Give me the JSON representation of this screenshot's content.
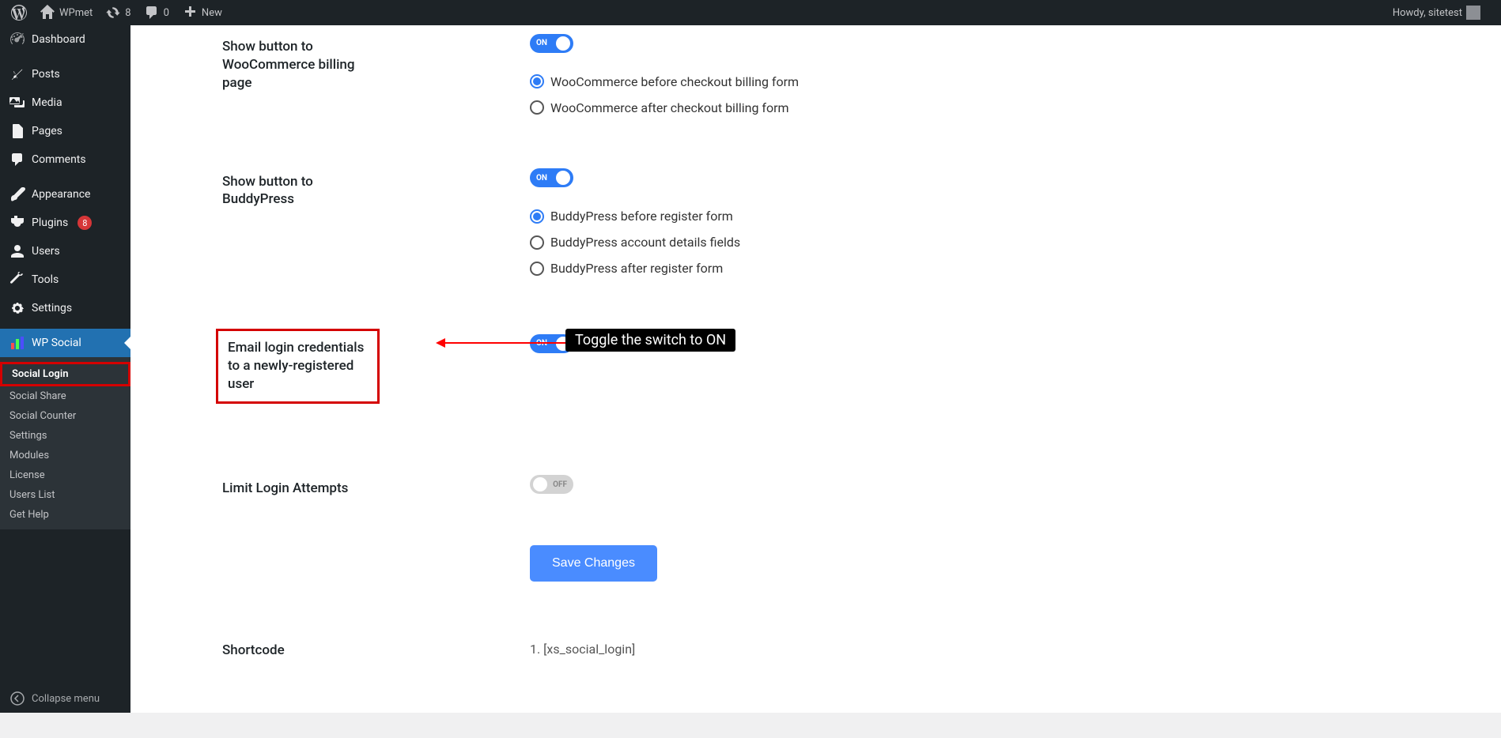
{
  "adminbar": {
    "site_name": "WPmet",
    "updates_count": "8",
    "comments_count": "0",
    "new_label": "New",
    "howdy": "Howdy, sitetest"
  },
  "sidebar": {
    "dashboard": "Dashboard",
    "posts": "Posts",
    "media": "Media",
    "pages": "Pages",
    "comments": "Comments",
    "appearance": "Appearance",
    "plugins": "Plugins",
    "plugins_badge": "8",
    "users": "Users",
    "tools": "Tools",
    "settings": "Settings",
    "wp_social": "WP Social",
    "collapse": "Collapse menu",
    "submenu": {
      "social_login": "Social Login",
      "social_share": "Social Share",
      "social_counter": "Social Counter",
      "settings": "Settings",
      "modules": "Modules",
      "license": "License",
      "users_list": "Users List",
      "get_help": "Get Help"
    }
  },
  "settings": {
    "woo": {
      "label": "Show button to WooCommerce billing page",
      "toggle": "ON",
      "radio1": "WooCommerce before checkout billing form",
      "radio2": "WooCommerce after checkout billing form"
    },
    "buddypress": {
      "label": "Show button to BuddyPress",
      "toggle": "ON",
      "radio1": "BuddyPress before register form",
      "radio2": "BuddyPress account details fields",
      "radio3": "BuddyPress after register form"
    },
    "email_creds": {
      "label": "Email login credentials to a newly-registered user",
      "toggle": "ON"
    },
    "limit_login": {
      "label": "Limit Login Attempts",
      "toggle": "OFF"
    },
    "save_button": "Save Changes",
    "shortcode": {
      "label": "Shortcode",
      "value": "1. [xs_social_login]"
    }
  },
  "annotation": {
    "label": "Toggle the switch to ON"
  }
}
